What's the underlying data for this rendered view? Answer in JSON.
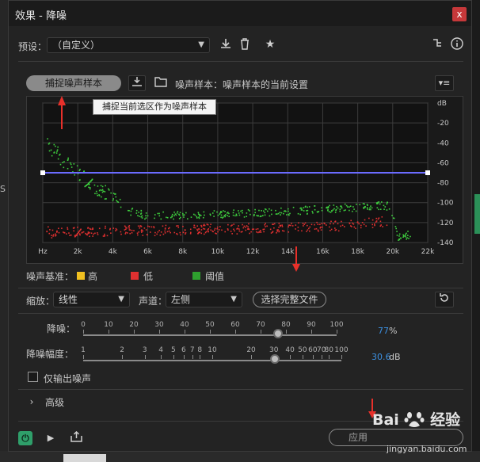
{
  "window": {
    "title": "效果 - 降噪",
    "close_label": "x"
  },
  "preset": {
    "label": "预设：",
    "value": "（自定义）"
  },
  "noise_print": {
    "capture_label": "捕捉噪声样本",
    "status_text": "噪声样本：噪声样本的当前设置",
    "tooltip": "捕捉当前选区作为噪声样本"
  },
  "chart_data": {
    "type": "scatter",
    "xlabel": "",
    "ylabel": "",
    "x_ticks": [
      "Hz",
      "2k",
      "4k",
      "6k",
      "8k",
      "10k",
      "12k",
      "14k",
      "16k",
      "18k",
      "20k",
      "22k"
    ],
    "y_ticks": [
      "dB",
      "-20",
      "-40",
      "-60",
      "-80",
      "-100",
      "-120",
      "-140"
    ],
    "xlim": [
      0,
      22000
    ],
    "ylim": [
      -140,
      0
    ],
    "grid": true,
    "threshold_line_db": -70,
    "series": [
      {
        "name": "阈值",
        "color": "#3fd03f",
        "x": [
          200,
          500,
          800,
          1200,
          1600,
          2000,
          2500,
          3000,
          3500,
          4000,
          4500,
          5000,
          5500,
          6000,
          7000,
          8000,
          9000,
          10000,
          11000,
          12000,
          13000,
          14000,
          15000,
          16000,
          17000,
          18000,
          19000,
          19800,
          20300,
          21000
        ],
        "y": [
          -40,
          -45,
          -50,
          -58,
          -63,
          -68,
          -78,
          -86,
          -90,
          -92,
          -102,
          -108,
          -110,
          -113,
          -112,
          -112,
          -111,
          -111,
          -110,
          -110,
          -109,
          -108,
          -107,
          -106,
          -105,
          -104,
          -102,
          -103,
          -134,
          -131
        ]
      },
      {
        "name": "低",
        "color": "#e03030",
        "x": [
          200,
          500,
          1000,
          2000,
          3000,
          4000,
          5000,
          6000,
          7000,
          8000,
          9000,
          10000,
          11000,
          12000,
          13000,
          14000,
          15000,
          16000,
          17000,
          18000,
          19000,
          19800
        ],
        "y": [
          -128,
          -130,
          -128,
          -129,
          -128,
          -128,
          -127,
          -128,
          -127,
          -127,
          -126,
          -126,
          -126,
          -125,
          -125,
          -124,
          -124,
          -123,
          -123,
          -121,
          -119,
          -118
        ]
      }
    ]
  },
  "legend": {
    "label": "噪声基准：",
    "items": [
      {
        "label": "高",
        "color": "#f0c020"
      },
      {
        "label": "低",
        "color": "#e03030"
      },
      {
        "label": "阈值",
        "color": "#2ea02e"
      }
    ]
  },
  "scale": {
    "label": "缩放：",
    "value": "线性"
  },
  "channel": {
    "label": "声道：",
    "value": "左侧"
  },
  "select_file_label": "选择完整文件",
  "reduction": {
    "label": "降噪：",
    "ticks": [
      "0",
      "10",
      "20",
      "30",
      "40",
      "50",
      "60",
      "70",
      "80",
      "90",
      "100"
    ],
    "value": 77,
    "value_text": "77",
    "unit": "%"
  },
  "reduce_by": {
    "label": "降噪幅度：",
    "ticks": [
      "1",
      "2",
      "3",
      "4",
      "5",
      "6",
      "7",
      "8",
      "10",
      "20",
      "30",
      "40",
      "50",
      "60",
      "70",
      "80",
      "100"
    ],
    "value": 30.6,
    "value_text": "30.6",
    "unit": "dB"
  },
  "output_noise_only": {
    "label": "仅输出噪声",
    "checked": false
  },
  "advanced": {
    "label": "高级"
  },
  "footer": {
    "apply_label": "应用"
  },
  "watermark": {
    "brand": "Bai",
    "brand2": "经验",
    "url": "jingyan.baidu.com"
  },
  "colors": {
    "accent": "#3b8fe0",
    "close": "#c6383a",
    "power": "#2f9f6a"
  }
}
